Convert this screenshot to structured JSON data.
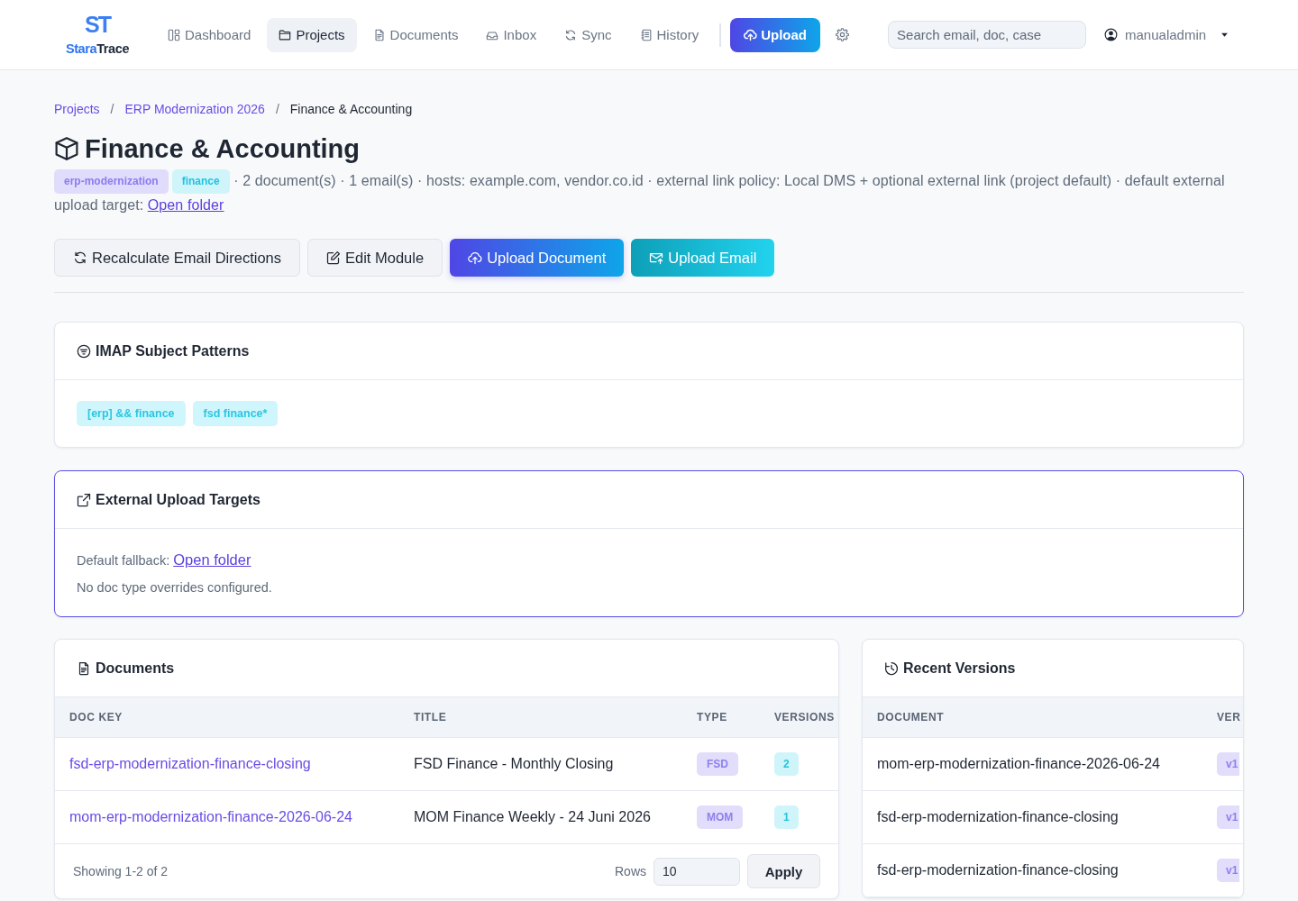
{
  "nav": {
    "brand": {
      "mark": "ST",
      "name_accent": "Stara",
      "name_rest": "Trace"
    },
    "items": [
      {
        "label": "Dashboard",
        "selected": false
      },
      {
        "label": "Projects",
        "selected": true
      },
      {
        "label": "Documents",
        "selected": false
      },
      {
        "label": "Inbox",
        "selected": false
      },
      {
        "label": "Sync",
        "selected": false
      },
      {
        "label": "History",
        "selected": false
      }
    ],
    "upload_button": "Upload",
    "search": {
      "placeholder": "Search email, doc, case"
    },
    "user": {
      "name": "manualadmin"
    }
  },
  "breadcrumb": {
    "items": [
      {
        "label": "Projects",
        "kind": "link"
      },
      {
        "label": "ERP Modernization 2026",
        "kind": "link"
      },
      {
        "label": "Finance & Accounting",
        "kind": "current"
      }
    ],
    "separators": [
      "/",
      "/"
    ]
  },
  "title": "Finance & Accounting",
  "summary": {
    "tags": [
      {
        "label": "erp-modernization",
        "kind": "primary"
      },
      {
        "label": "finance",
        "kind": "info"
      }
    ],
    "text": "· 2 document(s) · 1 email(s) · hosts: example.com, vendor.co.id · external link policy: Local DMS + optional external link (project default) · default external upload target:",
    "link": "Open folder"
  },
  "actions": [
    {
      "label": "Recalculate Email Directions",
      "kind": "secondary"
    },
    {
      "label": "Edit Module",
      "kind": "secondary"
    },
    {
      "label": "Upload Document",
      "kind": "primary"
    },
    {
      "label": "Upload Email",
      "kind": "info"
    }
  ],
  "patterns": {
    "title": "IMAP Subject Patterns",
    "highlighted": false,
    "chips": [
      "[erp] && finance",
      "fsd finance*"
    ]
  },
  "external_targets": {
    "title": "External Upload Targets",
    "highlighted": true,
    "fallback_label": "Default fallback:",
    "fallback_link": "Open folder",
    "note": "No doc type overrides configured."
  },
  "documents": {
    "title": "Documents",
    "highlighted": false,
    "columns": [
      "DOC KEY",
      "TITLE",
      "TYPE",
      "VERSIONS"
    ],
    "rows": [
      {
        "doc_key": "fsd-erp-modernization-finance-closing",
        "title": "FSD Finance - Monthly Closing",
        "type": "FSD",
        "versions": "2"
      },
      {
        "doc_key": "mom-erp-modernization-finance-2026-06-24",
        "title": "MOM Finance Weekly - 24 Juni 2026",
        "type": "MOM",
        "versions": "1"
      }
    ],
    "footer": {
      "showing": "Showing 1-2 of 2",
      "rows_label": "Rows",
      "rows_value": "10",
      "apply": "Apply"
    }
  },
  "recent_versions": {
    "title": "Recent Versions",
    "highlighted": false,
    "columns": [
      "DOCUMENT",
      "VER"
    ],
    "rows": [
      {
        "document": "mom-erp-modernization-finance-2026-06-24",
        "version": "v1"
      },
      {
        "document": "fsd-erp-modernization-finance-closing",
        "version": "v1"
      },
      {
        "document": "fsd-erp-modernization-finance-closing",
        "version": "v1"
      }
    ]
  }
}
